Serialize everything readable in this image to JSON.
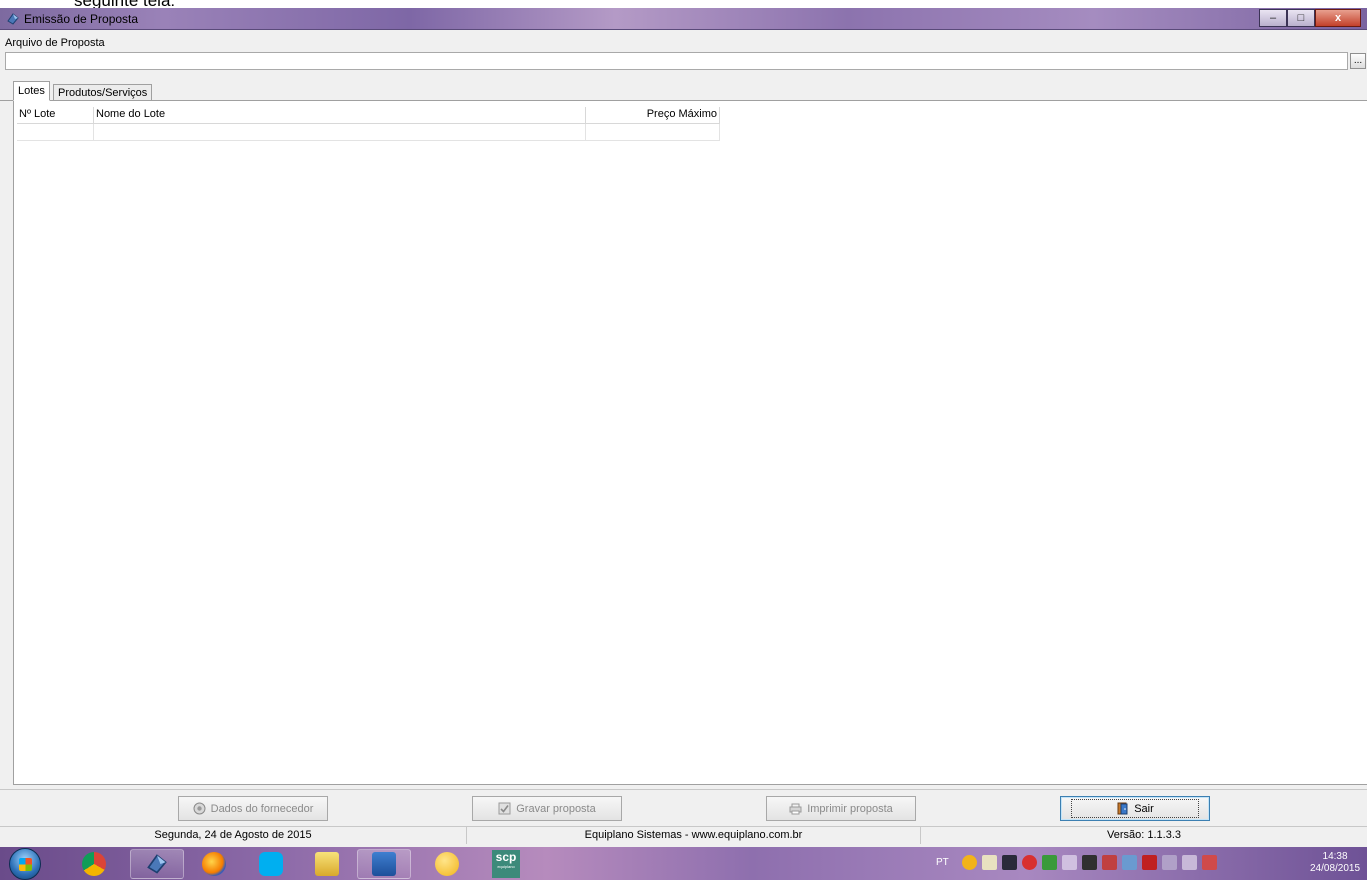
{
  "document_clip": "seguinte tela:",
  "window": {
    "title": "Emissão de Proposta",
    "controls": {
      "minimize": "–",
      "maximize": "□",
      "close": "x"
    }
  },
  "form": {
    "arquivo_label": "Arquivo de Proposta",
    "arquivo_value": "",
    "browse_label": "..."
  },
  "tabs": [
    {
      "label": "Lotes",
      "active": true
    },
    {
      "label": "Produtos/Serviços",
      "active": false
    }
  ],
  "grid": {
    "columns": [
      "Nº Lote",
      "Nome do Lote",
      "Preço Máximo"
    ],
    "rows": [
      [
        "",
        "",
        ""
      ]
    ]
  },
  "buttons": {
    "dados_fornecedor": "Dados do fornecedor",
    "gravar_proposta": "Gravar proposta",
    "imprimir_proposta": "Imprimir proposta",
    "sair": "Sair"
  },
  "status": {
    "date": "Segunda, 24 de Agosto de 2015",
    "company": "Equiplano Sistemas - www.equiplano.com.br",
    "version": "Versão: 1.1.3.3"
  },
  "taskbar": {
    "scp_label": "scp",
    "scp_sub": "equiplano",
    "language": "PT",
    "time": "14:38",
    "date": "24/08/2015"
  },
  "colors": {
    "window_bg": "#f0f0f0",
    "titlebar": "#8c73ae",
    "close_btn": "#c3402a",
    "focus_border": "#3c7fb1"
  }
}
